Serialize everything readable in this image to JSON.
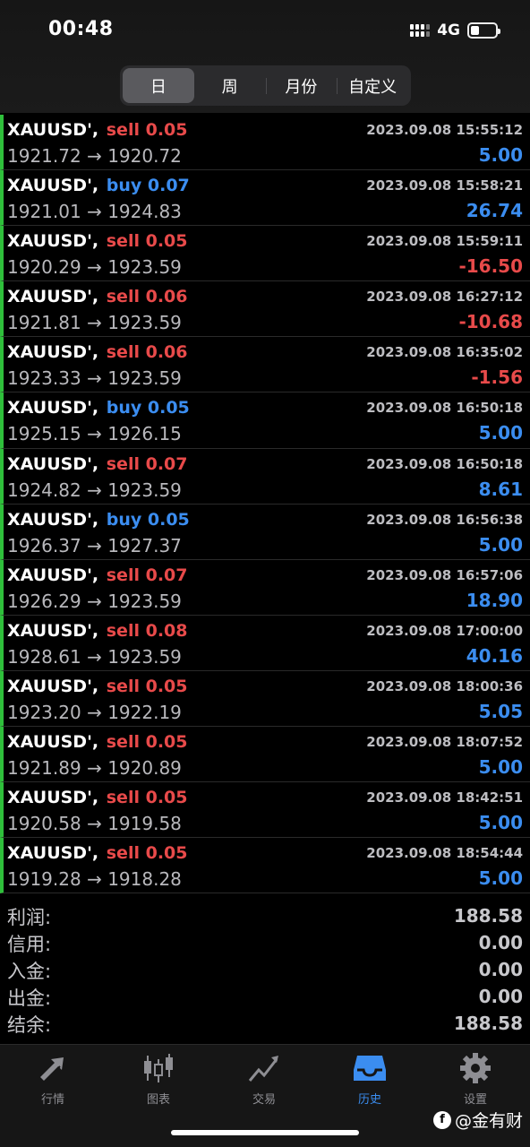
{
  "status_bar": {
    "time": "00:48",
    "network": "4G"
  },
  "period_tabs": [
    "日",
    "周",
    "月份",
    "自定义"
  ],
  "trades": [
    {
      "symbol": "XAUUSD',",
      "type": "sell",
      "volume": "0.05",
      "open": "1921.72",
      "close": "1920.72",
      "time": "2023.09.08 15:55:12",
      "profit": "5.00"
    },
    {
      "symbol": "XAUUSD',",
      "type": "buy",
      "volume": "0.07",
      "open": "1921.01",
      "close": "1924.83",
      "time": "2023.09.08 15:58:21",
      "profit": "26.74"
    },
    {
      "symbol": "XAUUSD',",
      "type": "sell",
      "volume": "0.05",
      "open": "1920.29",
      "close": "1923.59",
      "time": "2023.09.08 15:59:11",
      "profit": "-16.50"
    },
    {
      "symbol": "XAUUSD',",
      "type": "sell",
      "volume": "0.06",
      "open": "1921.81",
      "close": "1923.59",
      "time": "2023.09.08 16:27:12",
      "profit": "-10.68"
    },
    {
      "symbol": "XAUUSD',",
      "type": "sell",
      "volume": "0.06",
      "open": "1923.33",
      "close": "1923.59",
      "time": "2023.09.08 16:35:02",
      "profit": "-1.56"
    },
    {
      "symbol": "XAUUSD',",
      "type": "buy",
      "volume": "0.05",
      "open": "1925.15",
      "close": "1926.15",
      "time": "2023.09.08 16:50:18",
      "profit": "5.00"
    },
    {
      "symbol": "XAUUSD',",
      "type": "sell",
      "volume": "0.07",
      "open": "1924.82",
      "close": "1923.59",
      "time": "2023.09.08 16:50:18",
      "profit": "8.61"
    },
    {
      "symbol": "XAUUSD',",
      "type": "buy",
      "volume": "0.05",
      "open": "1926.37",
      "close": "1927.37",
      "time": "2023.09.08 16:56:38",
      "profit": "5.00"
    },
    {
      "symbol": "XAUUSD',",
      "type": "sell",
      "volume": "0.07",
      "open": "1926.29",
      "close": "1923.59",
      "time": "2023.09.08 16:57:06",
      "profit": "18.90"
    },
    {
      "symbol": "XAUUSD',",
      "type": "sell",
      "volume": "0.08",
      "open": "1928.61",
      "close": "1923.59",
      "time": "2023.09.08 17:00:00",
      "profit": "40.16"
    },
    {
      "symbol": "XAUUSD',",
      "type": "sell",
      "volume": "0.05",
      "open": "1923.20",
      "close": "1922.19",
      "time": "2023.09.08 18:00:36",
      "profit": "5.05"
    },
    {
      "symbol": "XAUUSD',",
      "type": "sell",
      "volume": "0.05",
      "open": "1921.89",
      "close": "1920.89",
      "time": "2023.09.08 18:07:52",
      "profit": "5.00"
    },
    {
      "symbol": "XAUUSD',",
      "type": "sell",
      "volume": "0.05",
      "open": "1920.58",
      "close": "1919.58",
      "time": "2023.09.08 18:42:51",
      "profit": "5.00"
    },
    {
      "symbol": "XAUUSD',",
      "type": "sell",
      "volume": "0.05",
      "open": "1919.28",
      "close": "1918.28",
      "time": "2023.09.08 18:54:44",
      "profit": "5.00"
    }
  ],
  "summary": [
    {
      "label": "利润:",
      "value": "188.58"
    },
    {
      "label": "信用:",
      "value": "0.00"
    },
    {
      "label": "入金:",
      "value": "0.00"
    },
    {
      "label": "出金:",
      "value": "0.00"
    },
    {
      "label": "结余:",
      "value": "188.58"
    }
  ],
  "tabbar": [
    {
      "label": "行情",
      "icon": "quotes-arrows-icon"
    },
    {
      "label": "图表",
      "icon": "candlestick-chart-icon"
    },
    {
      "label": "交易",
      "icon": "trade-line-icon"
    },
    {
      "label": "历史",
      "icon": "history-inbox-icon"
    },
    {
      "label": "设置",
      "icon": "gear-icon"
    }
  ],
  "colors": {
    "accent": "#3b8df0",
    "sell": "#e84a4a",
    "rowMarker": "#2fbf3b"
  },
  "watermark": "@金有财"
}
